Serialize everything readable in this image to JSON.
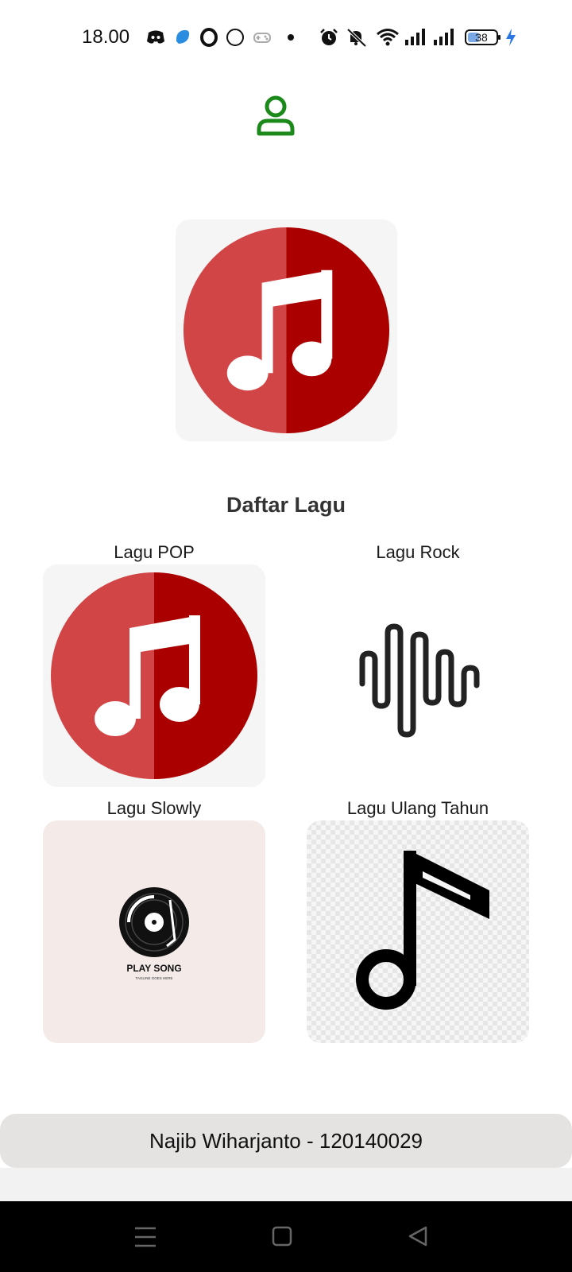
{
  "status_bar": {
    "time": "18.00",
    "battery_level": "38",
    "icons": [
      "discord-icon",
      "bluesky-icon",
      "opera-icon",
      "moon-icon",
      "game-controller-icon",
      "dot-icon",
      "alarm-icon",
      "mute-icon",
      "wifi-icon",
      "signal-icon",
      "signal-icon",
      "battery-icon",
      "charging-icon"
    ]
  },
  "header": {
    "profile_icon": "user-icon",
    "accent_color": "#1b8a1b"
  },
  "main": {
    "section_title": "Daftar Lagu",
    "categories": [
      {
        "label": "Lagu POP",
        "icon": "music-note-circle-icon"
      },
      {
        "label": "Lagu Rock",
        "icon": "sound-wave-icon"
      },
      {
        "label": "Lagu Slowly",
        "icon": "vinyl-record-icon",
        "caption": "PLAY SONG",
        "sub_caption": "TAGLINE GOES HERE"
      },
      {
        "label": "Lagu Ulang Tahun",
        "icon": "music-note-icon"
      }
    ]
  },
  "footer": {
    "text": "Najib Wiharjanto - 120140029"
  },
  "navigation": {
    "buttons": [
      "menu-icon",
      "home-icon",
      "back-icon"
    ]
  }
}
